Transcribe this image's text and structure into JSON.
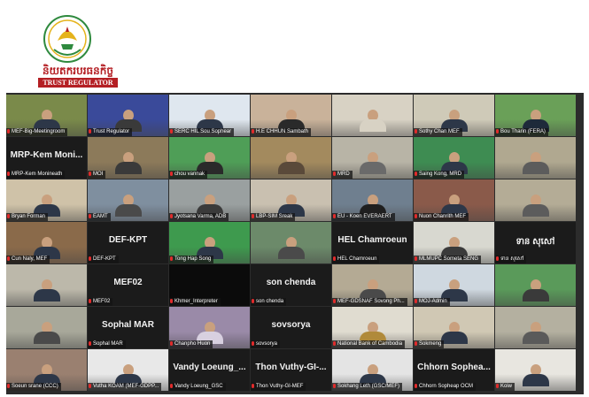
{
  "banner": {
    "org_name_khmer": "និយតករបរធនកិច្ច",
    "org_name_english": "TRUST REGULATOR",
    "emblem_text": "TRUST REGULATOR",
    "colors": {
      "brand_red": "#b41f24",
      "brand_green": "#2f8a3e",
      "brand_gold": "#e5b31c"
    }
  },
  "participants": [
    {
      "name": "MEF-Big-Meetingroom",
      "tile": "photo",
      "bg": "#7a8a4a",
      "person": "#2d3748",
      "hl": true
    },
    {
      "name": "Trust Regulator",
      "tile": "photo",
      "bg": "#3a4a9a",
      "person": "#3a3a3a"
    },
    {
      "name": "SERC HIL Sou Sophear",
      "tile": "photo",
      "bg": "#dfe7ef",
      "person": "#2d3748"
    },
    {
      "name": "H.E CHHUN Sambath",
      "tile": "photo",
      "bg": "#c9b29a",
      "person": "#2a2a2a"
    },
    {
      "name": "",
      "tile": "photo",
      "bg": "#d8d2c4",
      "person": "#d8d2c4"
    },
    {
      "name": "Sothy Chan MEF",
      "tile": "photo",
      "bg": "#cfcab8",
      "person": "#2d3748"
    },
    {
      "name": "Bou Tharin (FERA)",
      "tile": "photo",
      "bg": "#6aa058",
      "person": "#1e2a3a",
      "hl": true
    },
    {
      "name": "MRP-Kem Monineath",
      "tile": "text",
      "big": "MRP-Kem  Moni..."
    },
    {
      "name": "MOI",
      "tile": "photo",
      "bg": "#8c7a5a",
      "person": "#3a3a3a"
    },
    {
      "name": "chou vannak",
      "tile": "photo",
      "bg": "#4f9e57",
      "person": "#2a2a2a"
    },
    {
      "name": "",
      "tile": "photo",
      "bg": "#a38a5e",
      "person": "#5a4a3a"
    },
    {
      "name": "MRD",
      "tile": "photo",
      "bg": "#b8b4a6",
      "person": "#6a6a6a"
    },
    {
      "name": "Saing Kong, MRD",
      "tile": "photo",
      "bg": "#3e8c52",
      "person": "#2d3748"
    },
    {
      "name": "",
      "tile": "photo",
      "bg": "#b0a890",
      "person": "#5c5c5c"
    },
    {
      "name": "Bryan Forman",
      "tile": "photo",
      "bg": "#cfc2a8",
      "person": "#2d3748"
    },
    {
      "name": "EAMT",
      "tile": "photo",
      "bg": "#7f8f9f",
      "person": "#4a4a4a"
    },
    {
      "name": "Jyotsana Varma, ADB",
      "tile": "photo",
      "bg": "#9aa0a0",
      "person": "#3a3a3a"
    },
    {
      "name": "LBP-SIM Sreak",
      "tile": "photo",
      "bg": "#c9c0b0",
      "person": "#2d3748"
    },
    {
      "name": "EU - Koen EVERAERT",
      "tile": "photo",
      "bg": "#6f7f8f",
      "person": "#1f1f1f"
    },
    {
      "name": "Nuon Chanrith MEF",
      "tile": "photo",
      "bg": "#8a5a4a",
      "person": "#2d3748"
    },
    {
      "name": "",
      "tile": "photo",
      "bg": "#b4ac96",
      "person": "#5c5c5c"
    },
    {
      "name": "Cun Naly, MEF",
      "tile": "photo",
      "bg": "#8a6a4a",
      "person": "#2d3748"
    },
    {
      "name": "DEF-KPT",
      "tile": "text",
      "big": "DEF-KPT"
    },
    {
      "name": "Tong Hap Song",
      "tile": "photo",
      "bg": "#3e9a4e",
      "person": "#2d3748",
      "hl": true
    },
    {
      "name": "",
      "tile": "photo",
      "bg": "#6c8a6a",
      "person": "#4a4a4a"
    },
    {
      "name": "HEL Chamroeun",
      "tile": "text",
      "big": "HEL Chamroeun"
    },
    {
      "name": "MLMUPC Someta SENG",
      "tile": "photo",
      "bg": "#d8d8d0",
      "person": "#3a3a3a"
    },
    {
      "name": "ទាន សុសៅ",
      "tile": "text",
      "big": "ទាន សុសៅ"
    },
    {
      "name": "",
      "tile": "photo",
      "bg": "#bcb8aa",
      "person": "#2d3748"
    },
    {
      "name": "MEF02",
      "tile": "text",
      "big": "MEF02"
    },
    {
      "name": "Khmer_Interpreter",
      "tile": "dark"
    },
    {
      "name": "son chenda",
      "tile": "text",
      "big": "son chenda"
    },
    {
      "name": "MEF-GDSNAF Sovong Ph...",
      "tile": "photo",
      "bg": "#b4aa94",
      "person": "#4a4a4a"
    },
    {
      "name": "MOJ-Admin",
      "tile": "photo",
      "bg": "#cfd8e0",
      "person": "#2d3748"
    },
    {
      "name": "",
      "tile": "photo",
      "bg": "#5a9a5a",
      "person": "#3a3a3a",
      "hl": true
    },
    {
      "name": "",
      "tile": "photo",
      "bg": "#a8a89a",
      "person": "#4a4a4a"
    },
    {
      "name": "Sophal MAR",
      "tile": "text",
      "big": "Sophal MAR"
    },
    {
      "name": "Chanpho Huon",
      "tile": "photo",
      "bg": "#9a8aa8",
      "person": "#d8d0e0"
    },
    {
      "name": "sovsorya",
      "tile": "text",
      "big": "sovsorya"
    },
    {
      "name": "National Bank of Cambodia",
      "tile": "photo",
      "bg": "#e0dcd0",
      "person": "#b08a3a"
    },
    {
      "name": "Sokmeng",
      "tile": "photo",
      "bg": "#d0c8b4",
      "person": "#2d3748"
    },
    {
      "name": "",
      "tile": "photo",
      "bg": "#b4b0a0",
      "person": "#5a5a5a"
    },
    {
      "name": "Soeun srane (CCC)",
      "tile": "photo",
      "bg": "#9a8070",
      "person": "#2d3748"
    },
    {
      "name": "Vutha KOAM (MEF-GDPP...",
      "tile": "photo",
      "bg": "#e8e8e8",
      "person": "#2d3748"
    },
    {
      "name": "Vandy Loeung_GSC",
      "tile": "text",
      "big": "Vandy Loeung_..."
    },
    {
      "name": "Thon Vuthy-GI-MEF",
      "tile": "text",
      "big": "Thon Vuthy-GI-..."
    },
    {
      "name": "Sokhang Leth (GSC/MEF)",
      "tile": "photo",
      "bg": "#e4e4e4",
      "person": "#2d3748"
    },
    {
      "name": "Chhorn Sopheap OCM",
      "tile": "text",
      "big": "Chhorn Sophea..."
    },
    {
      "name": "Koiw",
      "tile": "photo",
      "bg": "#e8e6e0",
      "person": "#2d3748"
    }
  ]
}
